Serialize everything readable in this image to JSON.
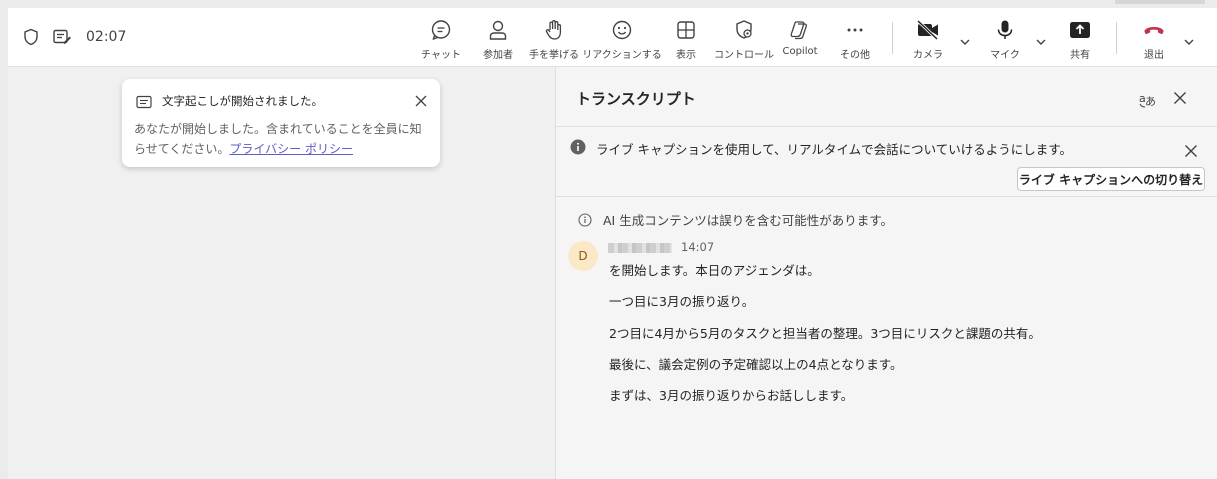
{
  "toolbar": {
    "timer": "02:07",
    "buttons": {
      "chat": "チャット",
      "participants": "参加者",
      "raise_hand": "手を挙げる",
      "reactions": "リアクションする",
      "view": "表示",
      "controls": "コントロール",
      "copilot": "Copilot",
      "more": "その他",
      "camera": "カメラ",
      "mic": "マイク",
      "share": "共有",
      "leave": "退出"
    },
    "colors": {
      "leave": "#c4314b"
    }
  },
  "toast": {
    "title": "文字起こしが開始されました。",
    "body": "あなたが開始しました。含まれていることを全員に知らせてください。",
    "link": "プライバシー ポリシー"
  },
  "panel": {
    "title": "トランスクリプト",
    "info_text": "ライブ キャプションを使用して、リアルタイムで会話についていけるようにします。",
    "switch_button": "ライブ キャプションへの切り替え",
    "ai_notice": "AI 生成コンテンツは誤りを含む可能性があります。",
    "entry": {
      "avatar_initial": "D",
      "time": "14:07",
      "lines": [
        "を開始します。本日のアジェンダは。",
        "一つ目に3月の振り返り。",
        "2つ目に4月から5月のタスクと担当者の整理。3つ目にリスクと課題の共有。",
        "最後に、議会定例の予定確認以上の4点となります。",
        "まずは、3月の振り返りからお話しします。"
      ]
    }
  }
}
